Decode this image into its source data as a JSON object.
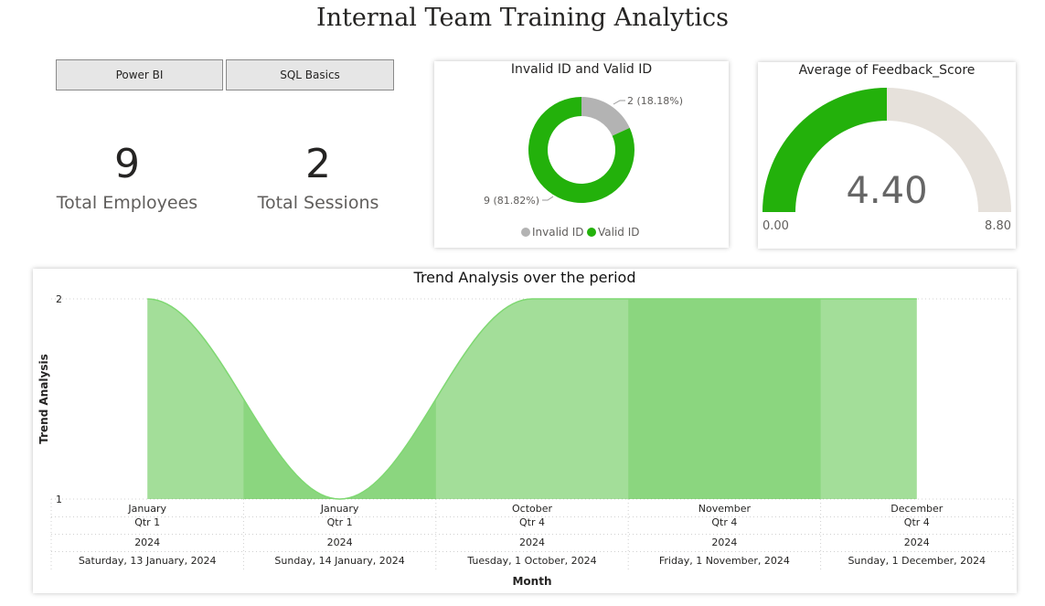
{
  "page": {
    "title": "Internal Team Training Analytics"
  },
  "slicer": {
    "items": [
      "Power BI",
      "SQL Basics"
    ]
  },
  "cards": {
    "employees": {
      "value": "9",
      "label": "Total Employees"
    },
    "sessions": {
      "value": "2",
      "label": "Total Sessions"
    }
  },
  "colors": {
    "green": "#23b10b",
    "gray": "#b3b3b3",
    "gauge_track": "#e6e1db"
  },
  "chart_data": [
    {
      "type": "pie",
      "donut": true,
      "title": "Invalid ID and Valid ID",
      "slices": [
        {
          "name": "Invalid ID",
          "value": 2,
          "label": "2 (18.18%)",
          "color": "#b3b3b3"
        },
        {
          "name": "Valid ID",
          "value": 9,
          "label": "9 (81.82%)",
          "color": "#23b10b"
        }
      ],
      "legend": [
        "Invalid ID",
        "Valid ID"
      ],
      "legend_position": "bottom"
    },
    {
      "type": "gauge",
      "title": "Average of Feedback_Score",
      "value": 4.4,
      "value_label": "4.40",
      "min": 0,
      "max": 8.8,
      "min_label": "0.00",
      "max_label": "8.80"
    },
    {
      "type": "area",
      "title": "Trend Analysis over the period",
      "ylabel": "Trend Analysis",
      "xlabel": "Month",
      "ylim": [
        1,
        2
      ],
      "yticks": [
        "2",
        "1"
      ],
      "grid": true,
      "categories": [
        {
          "month": "January",
          "quarter": "Qtr 1",
          "year": "2024",
          "date": "Saturday, 13 January, 2024"
        },
        {
          "month": "January",
          "quarter": "Qtr 1",
          "year": "2024",
          "date": "Sunday, 14 January, 2024"
        },
        {
          "month": "October",
          "quarter": "Qtr 4",
          "year": "2024",
          "date": "Tuesday, 1 October, 2024"
        },
        {
          "month": "November",
          "quarter": "Qtr 4",
          "year": "2024",
          "date": "Friday, 1 November, 2024"
        },
        {
          "month": "December",
          "quarter": "Qtr 4",
          "year": "2024",
          "date": "Sunday, 1 December, 2024"
        }
      ],
      "values": [
        2,
        1,
        2,
        2,
        2
      ],
      "color": "#23b10b"
    }
  ]
}
